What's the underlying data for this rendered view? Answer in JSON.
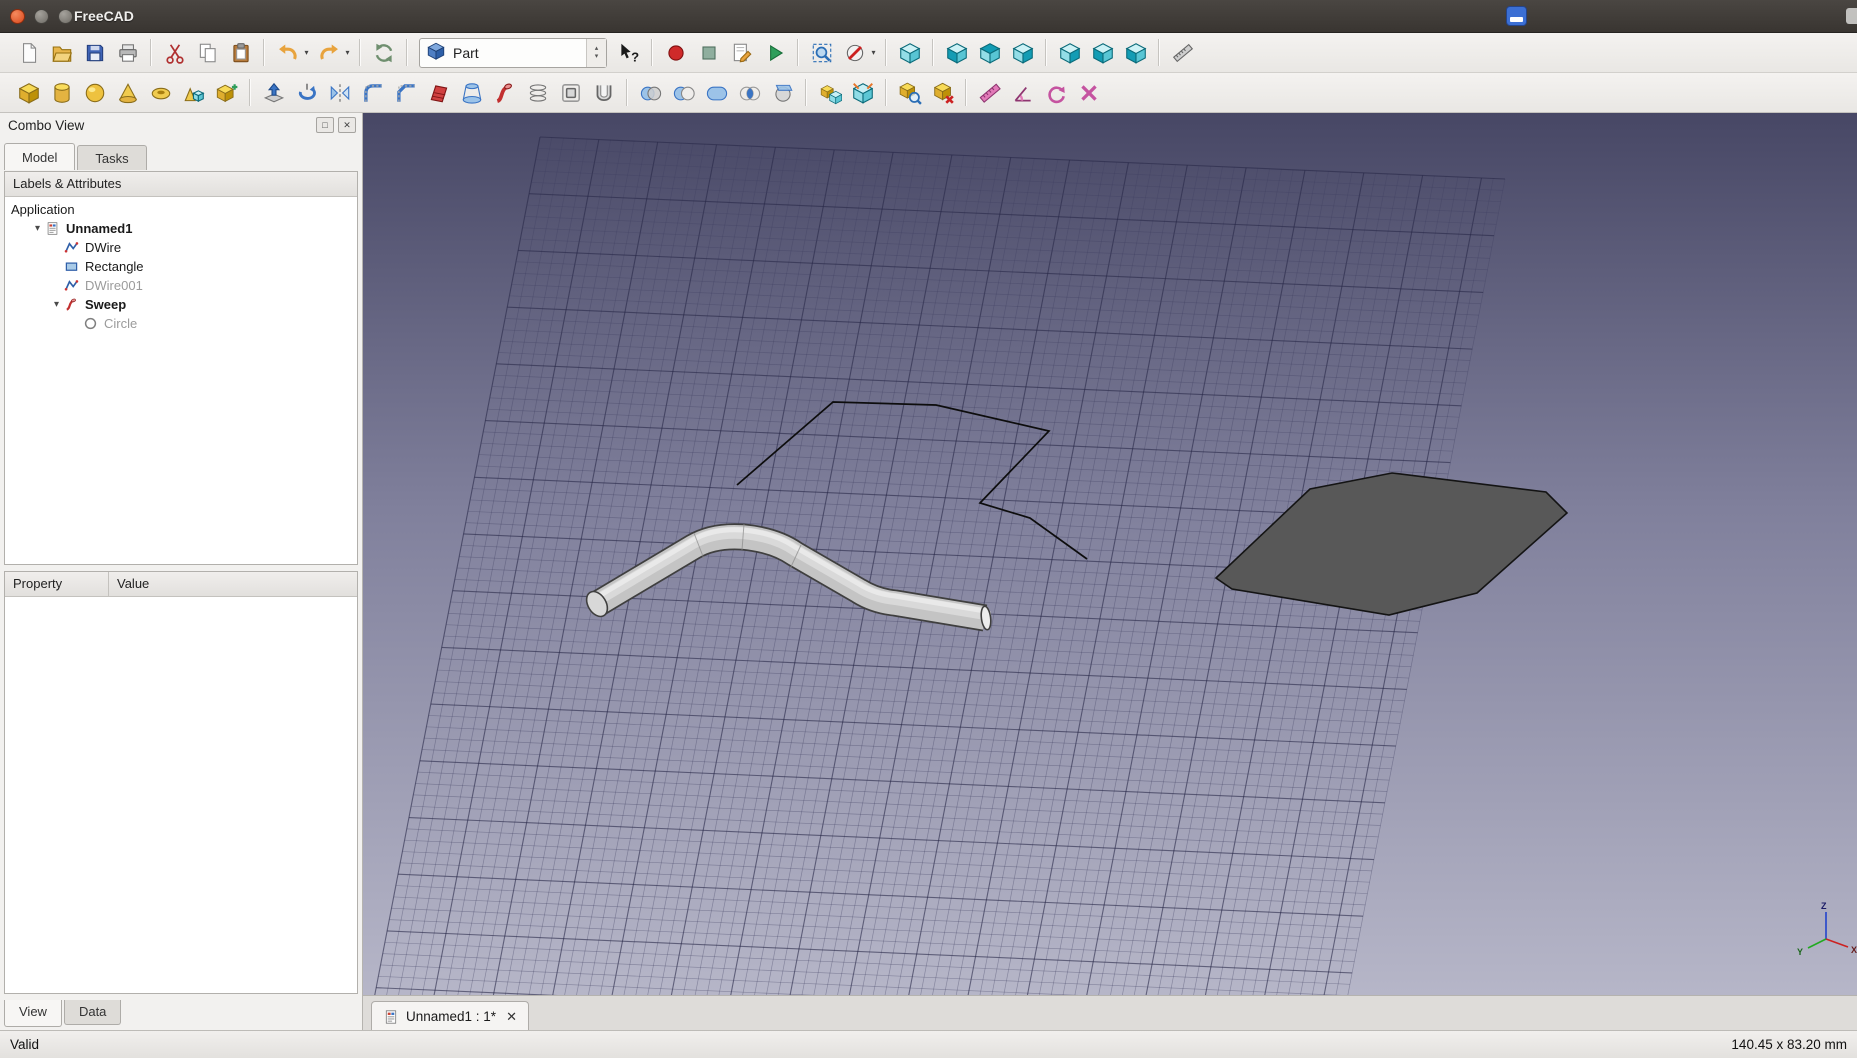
{
  "titlebar": {
    "title": "FreeCAD"
  },
  "toolbars": {
    "workbench_selector": {
      "value": "Part"
    },
    "row1": [
      {
        "name": "new-document"
      },
      {
        "name": "open-document"
      },
      {
        "name": "save-document"
      },
      {
        "name": "print-document"
      },
      {
        "sep": true
      },
      {
        "name": "cut"
      },
      {
        "name": "copy"
      },
      {
        "name": "paste"
      },
      {
        "sep": true
      },
      {
        "name": "undo",
        "dropdown": true
      },
      {
        "name": "redo",
        "dropdown": true
      },
      {
        "sep": true
      },
      {
        "name": "refresh"
      },
      {
        "sep": true
      },
      {
        "combo": true
      },
      {
        "name": "whats-this"
      },
      {
        "sep": true
      },
      {
        "name": "macro-record"
      },
      {
        "name": "macro-stop"
      },
      {
        "name": "macro-edit"
      },
      {
        "name": "macro-execute"
      },
      {
        "sep": true
      },
      {
        "name": "fit-all"
      },
      {
        "name": "draw-style",
        "dropdown": true
      },
      {
        "sep": true
      },
      {
        "name": "view-isometric"
      },
      {
        "sep": true
      },
      {
        "name": "view-front"
      },
      {
        "name": "view-top"
      },
      {
        "name": "view-right"
      },
      {
        "sep": true
      },
      {
        "name": "view-rear"
      },
      {
        "name": "view-bottom"
      },
      {
        "name": "view-left"
      },
      {
        "sep": true
      },
      {
        "name": "measure-distance"
      }
    ],
    "row2": [
      {
        "name": "part-box"
      },
      {
        "name": "part-cylinder"
      },
      {
        "name": "part-sphere"
      },
      {
        "name": "part-cone"
      },
      {
        "name": "part-torus"
      },
      {
        "name": "part-primitives"
      },
      {
        "name": "part-shape-builder"
      },
      {
        "sep": true
      },
      {
        "name": "part-extrude"
      },
      {
        "name": "part-revolve"
      },
      {
        "name": "part-mirror"
      },
      {
        "name": "part-fillet"
      },
      {
        "name": "part-chamfer"
      },
      {
        "name": "part-ruled-surface"
      },
      {
        "name": "part-loft"
      },
      {
        "name": "part-sweep"
      },
      {
        "name": "part-cross-sections"
      },
      {
        "name": "part-offset"
      },
      {
        "name": "part-thickness"
      },
      {
        "sep": true
      },
      {
        "name": "part-boolean"
      },
      {
        "name": "part-cut"
      },
      {
        "name": "part-union"
      },
      {
        "name": "part-intersection"
      },
      {
        "name": "part-section"
      },
      {
        "sep": true
      },
      {
        "name": "part-compound"
      },
      {
        "name": "part-connect"
      },
      {
        "sep": true
      },
      {
        "name": "part-check-geometry"
      },
      {
        "name": "part-defeaturing"
      },
      {
        "sep": true
      },
      {
        "name": "measure-linear"
      },
      {
        "name": "measure-angular"
      },
      {
        "name": "measure-refresh"
      },
      {
        "name": "measure-clear"
      }
    ]
  },
  "combo_view": {
    "title": "Combo View",
    "tabs": [
      {
        "label": "Model",
        "active": true
      },
      {
        "label": "Tasks",
        "active": false
      }
    ],
    "tree_header": "Labels & Attributes",
    "tree_items": [
      {
        "label": "Application",
        "depth": 0,
        "icon": null,
        "bold": false,
        "dimmed": false,
        "expander": null
      },
      {
        "label": "Unnamed1",
        "depth": 1,
        "icon": "freecad-document",
        "bold": true,
        "dimmed": false,
        "expander": "expanded"
      },
      {
        "label": "DWire",
        "depth": 2,
        "icon": "dwire",
        "bold": false,
        "dimmed": false,
        "expander": null
      },
      {
        "label": "Rectangle",
        "depth": 2,
        "icon": "rectangle",
        "bold": false,
        "dimmed": false,
        "expander": null
      },
      {
        "label": "DWire001",
        "depth": 2,
        "icon": "dwire",
        "bold": false,
        "dimmed": true,
        "expander": null
      },
      {
        "label": "Sweep",
        "depth": 2,
        "icon": "sweep",
        "bold": true,
        "dimmed": false,
        "expander": "expanded"
      },
      {
        "label": "Circle",
        "depth": 3,
        "icon": "circle",
        "bold": false,
        "dimmed": true,
        "expander": null
      }
    ],
    "property_table": {
      "columns": [
        "Property",
        "Value"
      ],
      "rows": []
    },
    "bottom_tabs": [
      {
        "label": "View",
        "active": true
      },
      {
        "label": "Data",
        "active": false
      }
    ]
  },
  "document_tabs": [
    {
      "label": "Unnamed1 : 1*",
      "active": true
    }
  ],
  "status_bar": {
    "left": "Valid",
    "right": "140.45 x 83.20 mm"
  },
  "viewport": {
    "axis_labels": [
      "X",
      "Y",
      "Z"
    ]
  }
}
